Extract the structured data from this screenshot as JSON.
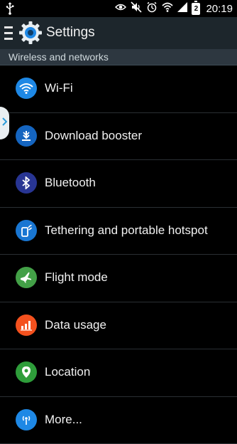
{
  "status_bar": {
    "time": "20:19",
    "battery_level": "2",
    "icons": [
      "usb-icon",
      "eye-icon",
      "mute-icon",
      "alarm-icon",
      "wifi-icon",
      "signal-icon",
      "battery-icon"
    ]
  },
  "action_bar": {
    "title": "Settings",
    "icon": "gear-icon"
  },
  "section": {
    "title": "Wireless and networks"
  },
  "items": [
    {
      "label": "Wi-Fi",
      "icon": "wifi-icon",
      "color": "#1e88e5"
    },
    {
      "label": "Download booster",
      "icon": "download-icon",
      "color": "#1565c0"
    },
    {
      "label": "Bluetooth",
      "icon": "bluetooth-icon",
      "color": "#283593"
    },
    {
      "label": "Tethering and portable hotspot",
      "icon": "hotspot-icon",
      "color": "#1976d2"
    },
    {
      "label": "Flight mode",
      "icon": "airplane-icon",
      "color": "#43a047"
    },
    {
      "label": "Data usage",
      "icon": "data-usage-icon",
      "color": "#f4511e"
    },
    {
      "label": "Location",
      "icon": "location-icon",
      "color": "#2e9d3a"
    },
    {
      "label": "More...",
      "icon": "more-networks-icon",
      "color": "#1e88e5"
    }
  ]
}
